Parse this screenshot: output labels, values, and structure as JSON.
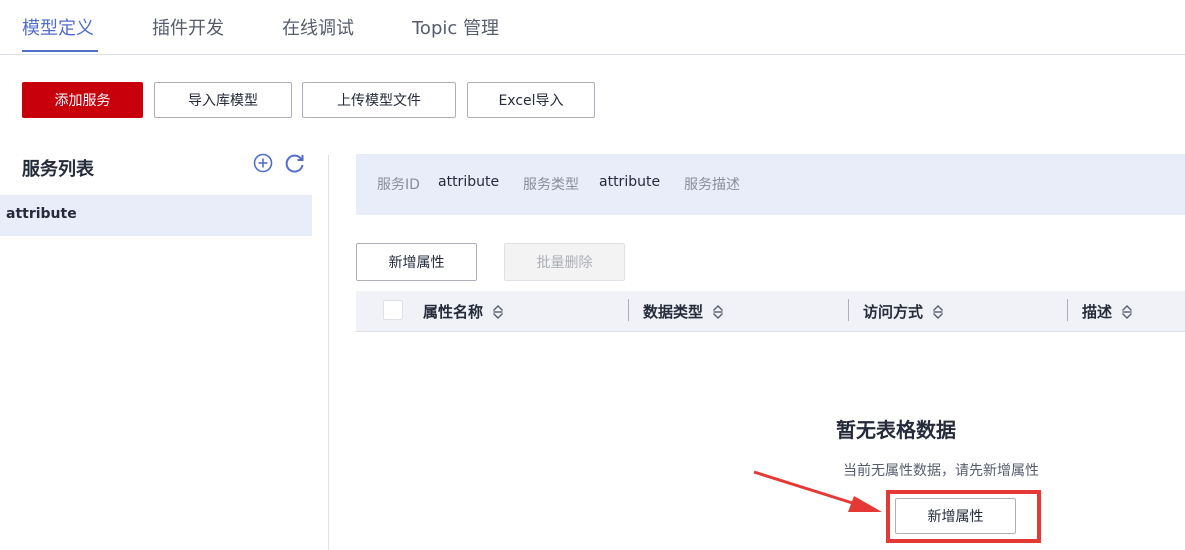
{
  "tabs": [
    {
      "label": "模型定义",
      "active": true
    },
    {
      "label": "插件开发",
      "active": false
    },
    {
      "label": "在线调试",
      "active": false
    },
    {
      "label": "Topic 管理",
      "active": false
    }
  ],
  "toolbar": {
    "add_service": "添加服务",
    "import_library_model": "导入库模型",
    "upload_model_file": "上传模型文件",
    "excel_import": "Excel导入"
  },
  "sidebar": {
    "title": "服务列表",
    "items": [
      {
        "label": "attribute",
        "selected": true
      }
    ],
    "icons": {
      "add": "add-circle-icon",
      "refresh": "refresh-icon"
    }
  },
  "service_info": {
    "id_label": "服务ID",
    "id_value": "attribute",
    "type_label": "服务类型",
    "type_value": "attribute",
    "desc_label": "服务描述",
    "desc_value": ""
  },
  "actions": {
    "add_property": "新增属性",
    "batch_delete": "批量删除"
  },
  "table": {
    "columns": [
      "属性名称",
      "数据类型",
      "访问方式",
      "描述"
    ],
    "rows": []
  },
  "empty_state": {
    "title": "暂无表格数据",
    "description": "当前无属性数据，请先新增属性",
    "button": "新增属性"
  },
  "colors": {
    "accent": "#526ecc",
    "primary_button": "#c7000b",
    "highlight": "#e53935",
    "selected_bg": "#e9edfa"
  }
}
